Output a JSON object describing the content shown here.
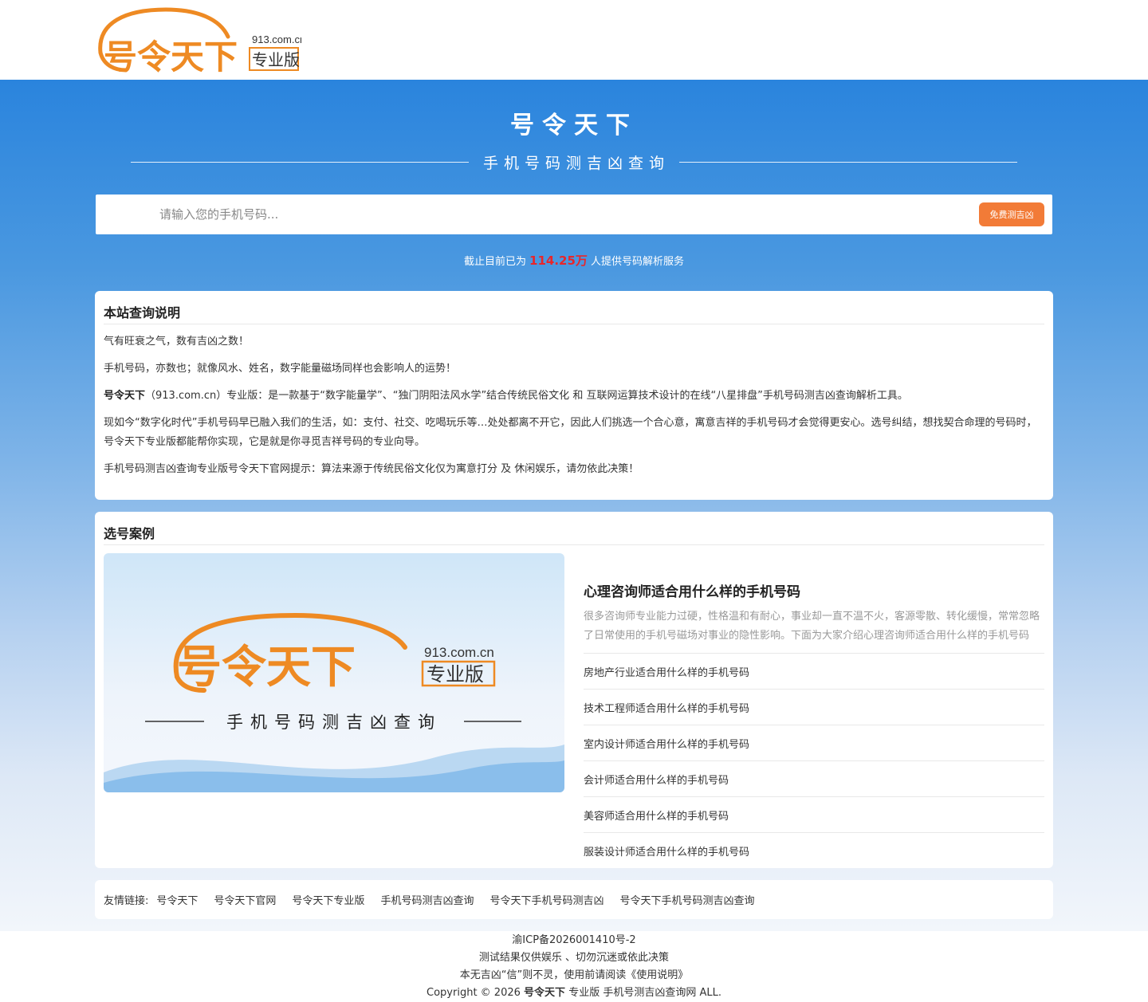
{
  "header": {
    "logo": {
      "brand": "号令天下",
      "domain": "913.com.cn",
      "edition": "专业版"
    }
  },
  "hero": {
    "title": "号令天下",
    "subtitle": "手机号码测吉凶查询"
  },
  "search": {
    "placeholder": "请输入您的手机号码...",
    "button": "免费测吉凶"
  },
  "stats": {
    "prefix": "截止目前已为",
    "count": "114.25万",
    "suffix": "人提供号码解析服务"
  },
  "intro": {
    "title": "本站查询说明",
    "p1": "气有旺衰之气，数有吉凶之数！",
    "p2": "手机号码，亦数也；就像风水、姓名，数字能量磁场同样也会影响人的运势！",
    "p3_brand": "号令天下",
    "p3_text": "（913.com.cn）专业版：是一款基于“数字能量学”、“独门阴阳法风水学”结合传统民俗文化 和 互联网运算技术设计的在线“八星排盘”手机号码测吉凶查询解析工具。",
    "p4": "现如今“数字化时代”手机号码早已融入我们的生活，如：支付、社交、吃喝玩乐等…处处都离不开它，因此人们挑选一个合心意，寓意吉祥的手机号码才会觉得更安心。选号纠结，想找契合命理的号码时，号令天下专业版都能帮你实现，它是就是你寻觅吉祥号码的专业向导。",
    "p5": "手机号码测吉凶查询专业版号令天下官网提示：算法来源于传统民俗文化仅为寓意打分 及 休闲娱乐，请勿依此决策！"
  },
  "cases": {
    "title": "选号案例",
    "banner": {
      "brand": "号令天下",
      "domain": "913.com.cn",
      "edition": "专业版",
      "tagline": "手机号码测吉凶查询"
    },
    "featured_title": "心理咨询师适合用什么样的手机号码",
    "featured_desc": "很多咨询师专业能力过硬，性格温和有耐心，事业却一直不温不火，客源零散、转化缓慢，常常忽略了日常使用的手机号磁场对事业的隐性影响。下面为大家介绍心理咨询师适合用什么样的手机号码",
    "items": [
      "房地产行业适合用什么样的手机号码",
      "技术工程师适合用什么样的手机号码",
      "室内设计师适合用什么样的手机号码",
      "会计师适合用什么样的手机号码",
      "美容师适合用什么样的手机号码",
      "服装设计师适合用什么样的手机号码"
    ]
  },
  "links": {
    "label": "友情链接:",
    "items": [
      "号令天下",
      "号令天下官网",
      "号令天下专业版",
      "手机号码测吉凶查询",
      "号令天下手机号码测吉凶",
      "号令天下手机号码测吉凶查询"
    ]
  },
  "footer": {
    "icp": "渝ICP备2026001410号-2",
    "line2": "测试结果仅供娱乐 、切勿沉迷或依此决策",
    "line3": "本无吉凶“信”则不灵，使用前请阅读《使用说明》",
    "copyright_prefix": "Copyright © 2026",
    "copyright_brand": "号令天下",
    "copyright_suffix": "专业版 手机号测吉凶查询网 ALL."
  },
  "colors": {
    "accent_orange": "#f27b37",
    "count_red": "#e8262b",
    "hero_blue": "#2a84dd"
  }
}
